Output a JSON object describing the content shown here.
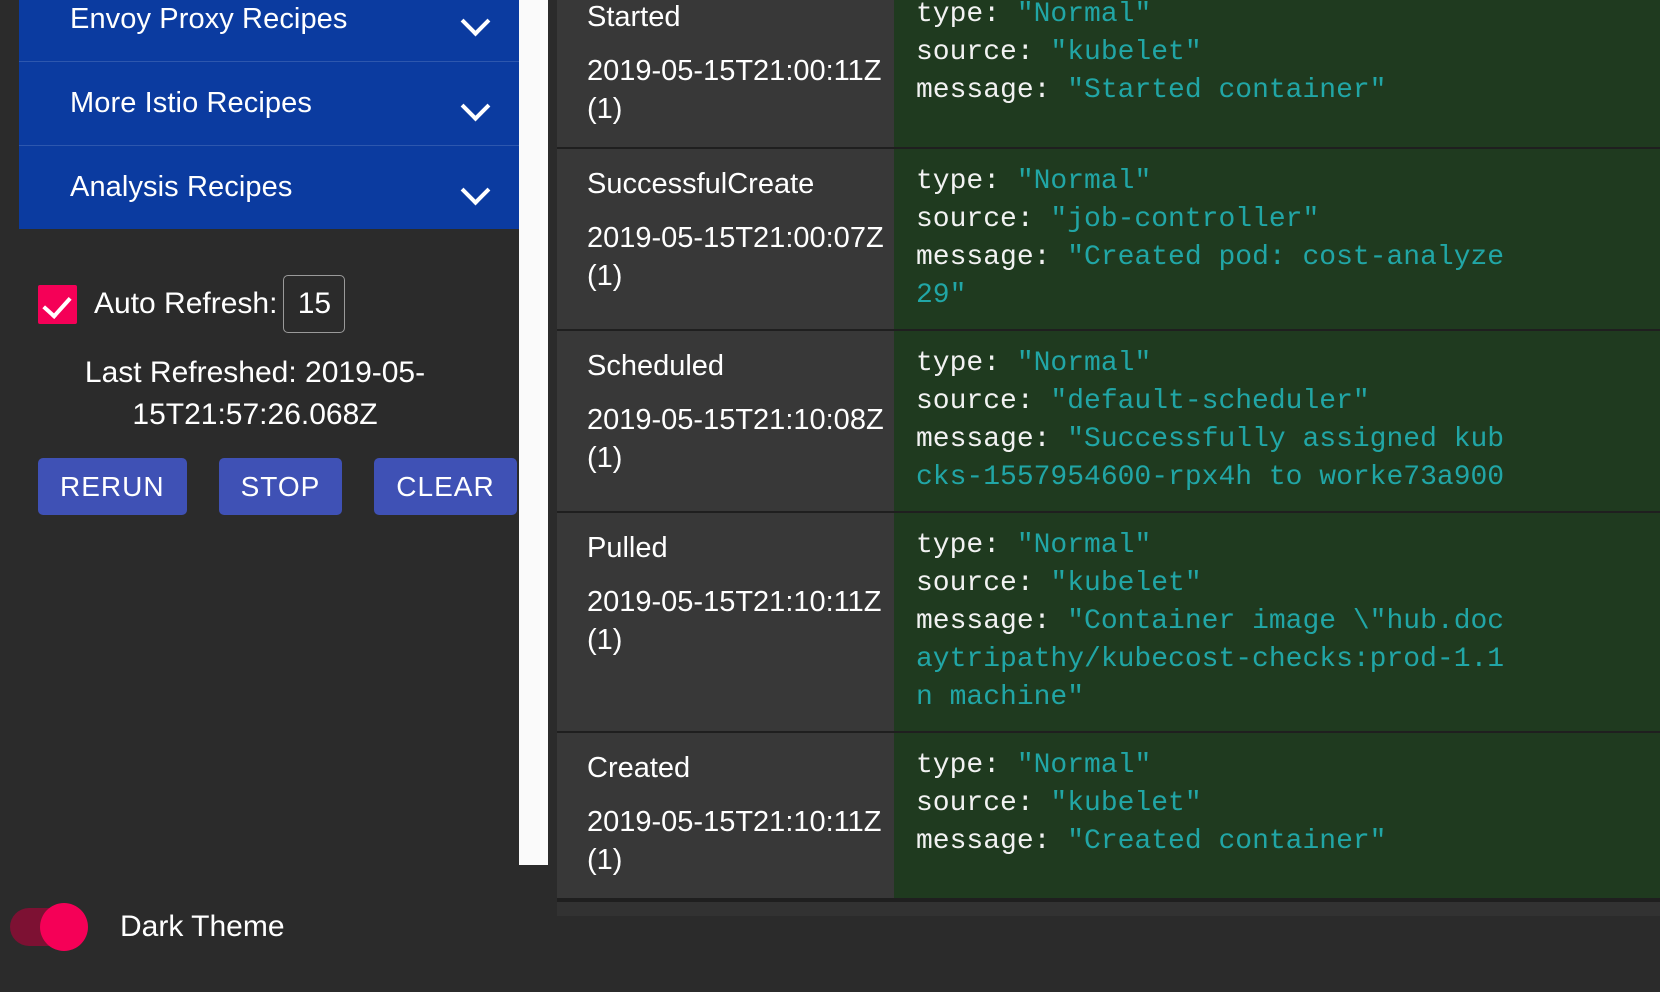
{
  "sidebar": {
    "accordion": [
      {
        "label": "Envoy Proxy Recipes",
        "icon": "chevron-down-icon",
        "expanded": false
      },
      {
        "label": "More Istio Recipes",
        "icon": "chevron-down-icon",
        "expanded": false
      },
      {
        "label": "Analysis Recipes",
        "icon": "chevron-down-icon",
        "expanded": false
      }
    ],
    "auto_refresh": {
      "label": "Auto Refresh:",
      "checked": true,
      "interval_value": "15"
    },
    "last_refreshed": "Last Refreshed: 2019-05-15T21:57:26.068Z",
    "buttons": [
      {
        "label": "RERUN",
        "name": "rerun-button"
      },
      {
        "label": "STOP",
        "name": "stop-button"
      },
      {
        "label": "CLEAR",
        "name": "clear-button"
      }
    ],
    "dark_theme": {
      "label": "Dark Theme",
      "on": true
    }
  },
  "colors": {
    "accordion_blue": "#0b3ba0",
    "button_indigo": "#3f51b5",
    "accent_pink": "#f50057",
    "panel_dark": "#2b2b2b",
    "row_dark": "#383838",
    "json_green_bg": "#1f3a1f",
    "json_value_teal": "#21a6a6"
  },
  "events": [
    {
      "name": "Started",
      "timestamp": "2019-05-15T21:00:11Z",
      "count": "(1)",
      "fields": [
        {
          "key": "type: ",
          "value": "\"Normal\""
        },
        {
          "key": "source: ",
          "value": "\"kubelet\""
        },
        {
          "key": "message: ",
          "value": "\"Started container\""
        }
      ]
    },
    {
      "name": "SuccessfulCreate",
      "timestamp": "2019-05-15T21:00:07Z",
      "count": "(1)",
      "fields": [
        {
          "key": "type: ",
          "value": "\"Normal\""
        },
        {
          "key": "source: ",
          "value": "\"job-controller\""
        },
        {
          "key": "message: ",
          "value": "\"Created pod: cost-analyze\n29\""
        }
      ]
    },
    {
      "name": "Scheduled",
      "timestamp": "2019-05-15T21:10:08Z",
      "count": "(1)",
      "fields": [
        {
          "key": "type: ",
          "value": "\"Normal\""
        },
        {
          "key": "source: ",
          "value": "\"default-scheduler\""
        },
        {
          "key": "message: ",
          "value": "\"Successfully assigned kub\ncks-1557954600-rpx4h to worke73a900"
        }
      ]
    },
    {
      "name": "Pulled",
      "timestamp": "2019-05-15T21:10:11Z",
      "count": "(1)",
      "fields": [
        {
          "key": "type: ",
          "value": "\"Normal\""
        },
        {
          "key": "source: ",
          "value": "\"kubelet\""
        },
        {
          "key": "message: ",
          "value": "\"Container image \\\"hub.doc\naytripathy/kubecost-checks:prod-1.1\nn machine\""
        }
      ]
    },
    {
      "name": "Created",
      "timestamp": "2019-05-15T21:10:11Z",
      "count": "(1)",
      "fields": [
        {
          "key": "type: ",
          "value": "\"Normal\""
        },
        {
          "key": "source: ",
          "value": "\"kubelet\""
        },
        {
          "key": "message: ",
          "value": "\"Created container\""
        }
      ]
    }
  ]
}
